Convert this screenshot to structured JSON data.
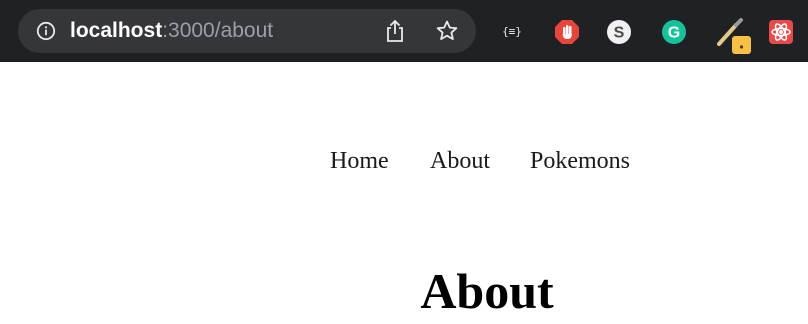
{
  "browser": {
    "url_host": "localhost",
    "url_path": ":3000/about",
    "extensions": [
      "json-viewer-icon",
      "adblock-icon",
      "s-extension-icon",
      "grammarly-icon",
      "brush-extension-icon",
      "react-devtools-icon"
    ],
    "json_ext_label": "{≡}"
  },
  "nav": {
    "items": [
      {
        "label": "Home"
      },
      {
        "label": "About"
      },
      {
        "label": "Pokemons"
      }
    ]
  },
  "page": {
    "title": "About"
  },
  "colors": {
    "toolbar_bg": "#202124",
    "omnibox_bg": "#35363a",
    "url_path": "#9aa0a6"
  }
}
